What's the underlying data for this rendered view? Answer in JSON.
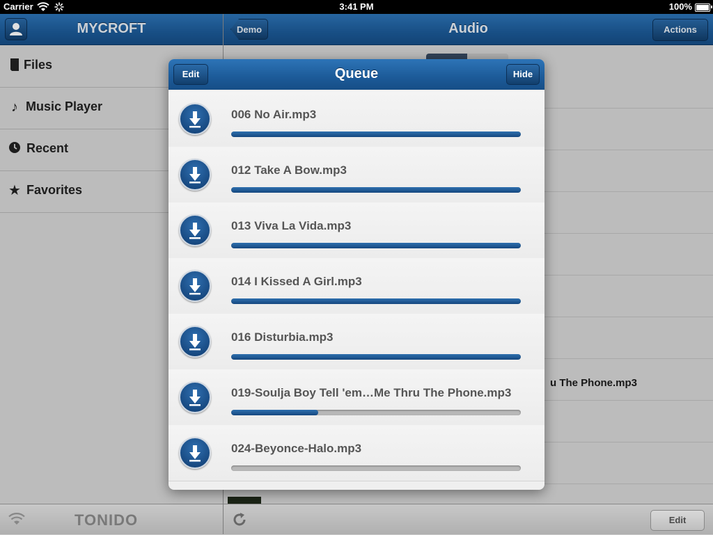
{
  "status_bar": {
    "carrier": "Carrier",
    "time": "3:41 PM",
    "battery": "100%"
  },
  "sidebar": {
    "title": "MYCROFT",
    "items": [
      {
        "label": "Files",
        "icon": "file-icon"
      },
      {
        "label": "Music Player",
        "icon": "music-note-icon"
      },
      {
        "label": "Recent",
        "icon": "clock-icon"
      },
      {
        "label": "Favorites",
        "icon": "star-icon"
      }
    ],
    "footer_logo": "TONIDO"
  },
  "main": {
    "title": "Audio",
    "back_label": "Demo",
    "actions_label": "Actions",
    "background_song": "u The Phone.mp3",
    "toolbar_edit_label": "Edit"
  },
  "queue": {
    "title": "Queue",
    "edit_label": "Edit",
    "hide_label": "Hide",
    "items": [
      {
        "name": "006 No Air.mp3",
        "progress": 1.0
      },
      {
        "name": "012 Take A Bow.mp3",
        "progress": 1.0
      },
      {
        "name": "013 Viva La Vida.mp3",
        "progress": 1.0
      },
      {
        "name": "014 I Kissed A Girl.mp3",
        "progress": 1.0
      },
      {
        "name": "016 Disturbia.mp3",
        "progress": 1.0
      },
      {
        "name": "019-Soulja Boy Tell 'em…Me Thru The Phone.mp3",
        "progress": 0.3
      },
      {
        "name": "024-Beyonce-Halo.mp3",
        "progress": 0.0
      }
    ]
  },
  "colors": {
    "nav_blue": "#1c5a98",
    "progress_blue": "#15487f"
  }
}
